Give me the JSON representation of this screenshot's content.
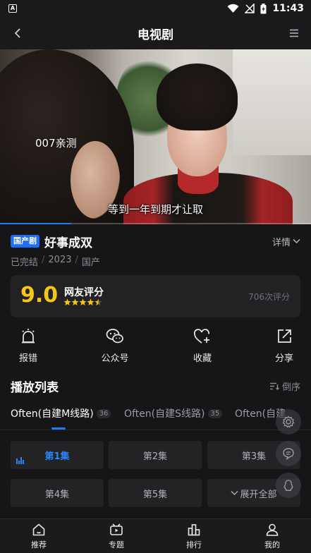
{
  "status_bar": {
    "time": "11:43",
    "left_icon": "A"
  },
  "app_bar": {
    "title": "电视剧"
  },
  "player": {
    "watermark": "007亲测",
    "subtitle": "等到一年到期才让取",
    "progress_fraction": 0.23
  },
  "show": {
    "tag": "国产剧",
    "title": "好事成双",
    "detail_label": "详情",
    "meta": [
      "已完结",
      "2023",
      "国产"
    ]
  },
  "rating": {
    "score": "9.0",
    "label": "网友评分",
    "stars": 4.5,
    "count_text": "706次评分"
  },
  "actions": [
    {
      "label": "报错",
      "icon": "alarm-icon"
    },
    {
      "label": "公众号",
      "icon": "wechat-icon"
    },
    {
      "label": "收藏",
      "icon": "heart-plus-icon"
    },
    {
      "label": "分享",
      "icon": "share-icon"
    }
  ],
  "playlist": {
    "title": "播放列表",
    "sort_label": "倒序",
    "sources": [
      {
        "name": "Often(自建M线路)",
        "count": "36",
        "active": true
      },
      {
        "name": "Often(自建S线路)",
        "count": "35",
        "active": false
      },
      {
        "name": "Often(自建",
        "count": "",
        "active": false
      }
    ],
    "episodes": [
      "第1集",
      "第2集",
      "第3集",
      "第4集",
      "第5集"
    ],
    "expand_label": "展开全部"
  },
  "bottom_nav": [
    {
      "label": "推荐",
      "icon": "home-icon"
    },
    {
      "label": "专题",
      "icon": "tv-icon"
    },
    {
      "label": "排行",
      "icon": "ranking-icon"
    },
    {
      "label": "我的",
      "icon": "profile-icon"
    }
  ],
  "colors": {
    "accent": "#1e7bf2",
    "rating": "#f5c518",
    "background": "#161618"
  }
}
